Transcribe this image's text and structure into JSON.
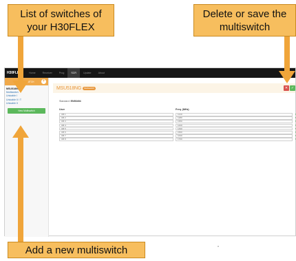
{
  "callouts": {
    "list_switches": {
      "line1": "List of switches of",
      "line2": "your H30FLEX"
    },
    "delete_save": {
      "line1": "Delete or save the",
      "line2": "multiswitch"
    },
    "add_new": {
      "text": "Add a new multiswitch"
    }
  },
  "app": {
    "logo": "H30FLEX",
    "nav": [
      "Home",
      "Receiver",
      "Prog",
      "SCR",
      "Update",
      "About"
    ],
    "active_nav": "SCR",
    "sidebar": {
      "header_label": "MULTISWITCH",
      "plus_icon": "+",
      "items": [
        "MSU518NG",
        "Multiswitch",
        "Unicable I",
        "Unicable II / T",
        "Unicable II"
      ],
      "selected_index": 0,
      "add_button": "New Multiswitch"
    },
    "panel": {
      "title": "MSU518NG",
      "badge": "Multiswitch",
      "delete_icon": "✕",
      "save_icon": "✓",
      "standard_label": "Standard:",
      "standard_value": "EN50494"
    },
    "table": {
      "headers": {
        "port": "User",
        "freq": "Freq. (MHz)"
      },
      "rows": [
        {
          "port": "UB 1",
          "freq": "1210",
          "check": "✓"
        },
        {
          "port": "UB 2",
          "freq": "1280",
          "check": "✓"
        },
        {
          "port": "UB 3",
          "freq": "1350",
          "check": "✓"
        },
        {
          "port": "UB 4",
          "freq": "1420",
          "check": "✓"
        },
        {
          "port": "UB 5",
          "freq": "1490",
          "check": "✓"
        },
        {
          "port": "UB 6",
          "freq": "1560",
          "check": "✓"
        },
        {
          "port": "UB 7",
          "freq": "1630",
          "check": "✓"
        },
        {
          "port": "UB 8",
          "freq": "1700",
          "check": "✓"
        }
      ]
    },
    "scroll_marker": "▾"
  },
  "colors": {
    "callout": "#f7be5e",
    "arrow": "#f0a53a",
    "accent": "#e8963a",
    "topbar": "#161616",
    "save": "#5cb85c",
    "delete": "#d9534f"
  }
}
